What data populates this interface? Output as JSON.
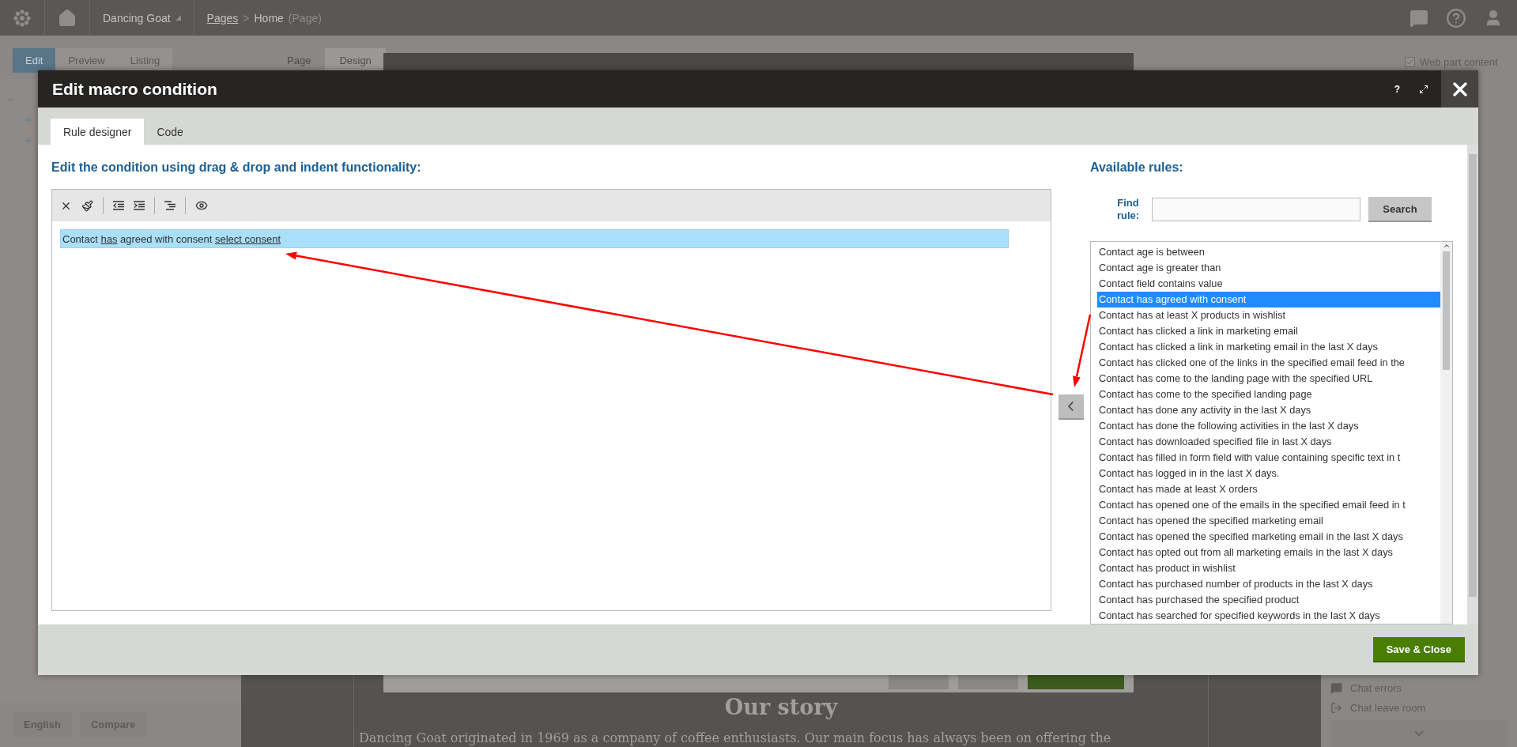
{
  "topbar": {
    "site": "Dancing Goat",
    "breadcrumb": [
      {
        "text": "Pages",
        "kind": "link"
      },
      {
        "text": "Home",
        "kind": "current"
      }
    ],
    "page_type": "(Page)",
    "separator": ">"
  },
  "left_panel": {
    "tabs": [
      {
        "label": "Edit",
        "selected": true
      },
      {
        "label": "Preview",
        "selected": false
      },
      {
        "label": "Listing",
        "selected": false
      }
    ],
    "language": "English",
    "compare": "Compare"
  },
  "view_tabs": [
    {
      "label": "Page",
      "selected": false
    },
    {
      "label": "Design",
      "selected": true
    }
  ],
  "preview": {
    "heading": "Our story",
    "paragraph": "Dancing Goat originated in 1969 as a company of coffee enthusiasts. Our main focus has always been on offering the"
  },
  "right_panel": {
    "web_part_content": {
      "label": "Web part content",
      "checked": true
    },
    "items": [
      {
        "label": "Chat errors",
        "kind": "chat"
      },
      {
        "label": "Chat leave room",
        "kind": "leave"
      }
    ]
  },
  "dialog": {
    "title": "Edit macro condition",
    "help": "?",
    "tabs": [
      {
        "label": "Rule designer",
        "selected": true
      },
      {
        "label": "Code",
        "selected": false
      }
    ],
    "editor_heading": "Edit the condition using drag & drop and indent functionality:",
    "condition": [
      {
        "text": "Contact ",
        "kind": "text"
      },
      {
        "text": "has",
        "kind": "link"
      },
      {
        "text": " agreed with consent ",
        "kind": "text"
      },
      {
        "text": "select consent",
        "kind": "link"
      }
    ],
    "rules_heading": "Available rules:",
    "find_label": "Find rule:",
    "search_button": "Search",
    "rules": [
      {
        "label": "Contact age is between",
        "selected": false
      },
      {
        "label": "Contact age is greater than",
        "selected": false
      },
      {
        "label": "Contact field contains value",
        "selected": false
      },
      {
        "label": "Contact has agreed with consent",
        "selected": true
      },
      {
        "label": "Contact has at least X products in wishlist",
        "selected": false
      },
      {
        "label": "Contact has clicked a link in marketing email",
        "selected": false
      },
      {
        "label": "Contact has clicked a link in marketing email in the last X days",
        "selected": false
      },
      {
        "label": "Contact has clicked one of the links in the specified email feed in the",
        "selected": false
      },
      {
        "label": "Contact has come to the landing page with the specified URL",
        "selected": false
      },
      {
        "label": "Contact has come to the specified landing page",
        "selected": false
      },
      {
        "label": "Contact has done any activity in the last X days",
        "selected": false
      },
      {
        "label": "Contact has done the following activities in the last X days",
        "selected": false
      },
      {
        "label": "Contact has downloaded specified file in last X days",
        "selected": false
      },
      {
        "label": "Contact has filled in form field with value containing specific text in t",
        "selected": false
      },
      {
        "label": "Contact has logged in in the last X days.",
        "selected": false
      },
      {
        "label": "Contact has made at least X orders",
        "selected": false
      },
      {
        "label": "Contact has opened one of the emails in the specified email feed in t",
        "selected": false
      },
      {
        "label": "Contact has opened the specified marketing email",
        "selected": false
      },
      {
        "label": "Contact has opened the specified marketing email in the last X days",
        "selected": false
      },
      {
        "label": "Contact has opted out from all marketing emails in the last X days",
        "selected": false
      },
      {
        "label": "Contact has product in wishlist",
        "selected": false
      },
      {
        "label": "Contact has purchased number of products in the last X days",
        "selected": false
      },
      {
        "label": "Contact has purchased the specified product",
        "selected": false
      },
      {
        "label": "Contact has searched for specified keywords in the last X days",
        "selected": false
      }
    ],
    "save_button": "Save & Close"
  }
}
